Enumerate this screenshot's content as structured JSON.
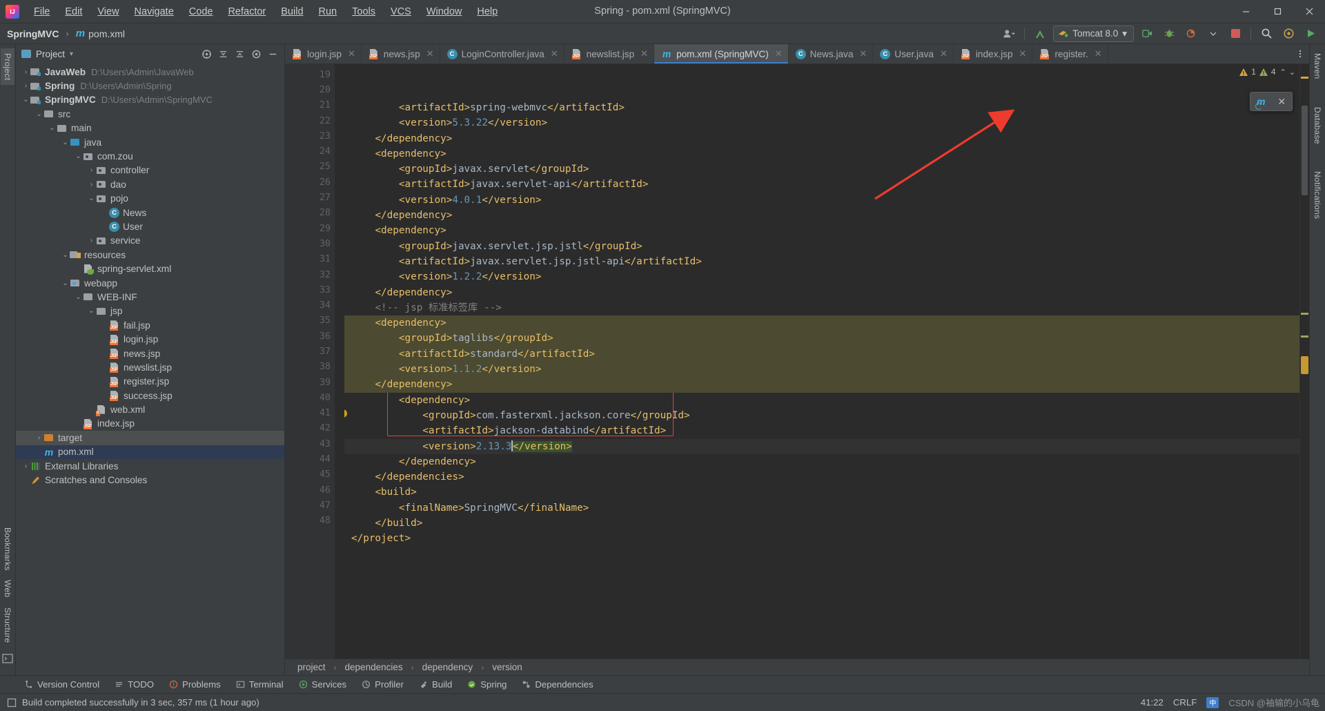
{
  "window": {
    "title": "Spring - pom.xml (SpringMVC)",
    "minimize": "—",
    "maximize": "❐",
    "close": "✕"
  },
  "menu": [
    {
      "label": "File"
    },
    {
      "label": "Edit"
    },
    {
      "label": "View"
    },
    {
      "label": "Navigate"
    },
    {
      "label": "Code"
    },
    {
      "label": "Refactor"
    },
    {
      "label": "Build"
    },
    {
      "label": "Run"
    },
    {
      "label": "Tools"
    },
    {
      "label": "VCS"
    },
    {
      "label": "Window"
    },
    {
      "label": "Help"
    }
  ],
  "navbar": {
    "project": "SpringMVC",
    "file": "pom.xml",
    "maven_glyph": "m",
    "run_config": "Tomcat 8.0",
    "dropdown_caret": "▾"
  },
  "left_rail": {
    "project_tab": "Project",
    "bookmarks_tab": "Bookmarks",
    "web_tab": "Web",
    "structure_tab": "Structure"
  },
  "right_rail": {
    "maven_tab": "Maven",
    "database_tab": "Database",
    "notifications_tab": "Notifications"
  },
  "project_panel": {
    "title": "Project",
    "caret": "▾",
    "tree": [
      {
        "depth": 0,
        "arrow": "›",
        "icon": "module-icon",
        "label": "JavaWeb",
        "bold": true,
        "path": "D:\\Users\\Admin\\JavaWeb"
      },
      {
        "depth": 0,
        "arrow": "›",
        "icon": "module-icon",
        "label": "Spring",
        "bold": true,
        "path": "D:\\Users\\Admin\\Spring"
      },
      {
        "depth": 0,
        "arrow": "⌄",
        "icon": "module-icon",
        "label": "SpringMVC",
        "bold": true,
        "path": "D:\\Users\\Admin\\SpringMVC"
      },
      {
        "depth": 1,
        "arrow": "⌄",
        "icon": "folder-icon",
        "label": "src",
        "bold": false,
        "path": ""
      },
      {
        "depth": 2,
        "arrow": "⌄",
        "icon": "folder-icon",
        "label": "main",
        "bold": false,
        "path": ""
      },
      {
        "depth": 3,
        "arrow": "⌄",
        "icon": "source-folder-icon",
        "label": "java",
        "bold": false,
        "path": ""
      },
      {
        "depth": 4,
        "arrow": "⌄",
        "icon": "package-icon",
        "label": "com.zou",
        "bold": false,
        "path": ""
      },
      {
        "depth": 5,
        "arrow": "›",
        "icon": "package-icon",
        "label": "controller",
        "bold": false,
        "path": ""
      },
      {
        "depth": 5,
        "arrow": "›",
        "icon": "package-icon",
        "label": "dao",
        "bold": false,
        "path": ""
      },
      {
        "depth": 5,
        "arrow": "⌄",
        "icon": "package-icon",
        "label": "pojo",
        "bold": false,
        "path": ""
      },
      {
        "depth": 6,
        "arrow": "",
        "icon": "java-class-icon",
        "label": "News",
        "bold": false,
        "path": ""
      },
      {
        "depth": 6,
        "arrow": "",
        "icon": "java-class-icon",
        "label": "User",
        "bold": false,
        "path": ""
      },
      {
        "depth": 5,
        "arrow": "›",
        "icon": "package-icon",
        "label": "service",
        "bold": false,
        "path": ""
      },
      {
        "depth": 3,
        "arrow": "⌄",
        "icon": "resources-folder-icon",
        "label": "resources",
        "bold": false,
        "path": ""
      },
      {
        "depth": 4,
        "arrow": "",
        "icon": "spring-xml-icon",
        "label": "spring-servlet.xml",
        "bold": false,
        "path": ""
      },
      {
        "depth": 3,
        "arrow": "⌄",
        "icon": "webapp-folder-icon",
        "label": "webapp",
        "bold": false,
        "path": ""
      },
      {
        "depth": 4,
        "arrow": "⌄",
        "icon": "folder-icon",
        "label": "WEB-INF",
        "bold": false,
        "path": ""
      },
      {
        "depth": 5,
        "arrow": "⌄",
        "icon": "folder-icon",
        "label": "jsp",
        "bold": false,
        "path": ""
      },
      {
        "depth": 6,
        "arrow": "",
        "icon": "jsp-file-icon",
        "label": "fail.jsp",
        "bold": false,
        "path": ""
      },
      {
        "depth": 6,
        "arrow": "",
        "icon": "jsp-file-icon",
        "label": "login.jsp",
        "bold": false,
        "path": ""
      },
      {
        "depth": 6,
        "arrow": "",
        "icon": "jsp-file-icon",
        "label": "news.jsp",
        "bold": false,
        "path": ""
      },
      {
        "depth": 6,
        "arrow": "",
        "icon": "jsp-file-icon",
        "label": "newslist.jsp",
        "bold": false,
        "path": ""
      },
      {
        "depth": 6,
        "arrow": "",
        "icon": "jsp-file-icon",
        "label": "register.jsp",
        "bold": false,
        "path": ""
      },
      {
        "depth": 6,
        "arrow": "",
        "icon": "jsp-file-icon",
        "label": "success.jsp",
        "bold": false,
        "path": ""
      },
      {
        "depth": 5,
        "arrow": "",
        "icon": "xml-file-icon",
        "label": "web.xml",
        "bold": false,
        "path": ""
      },
      {
        "depth": 4,
        "arrow": "",
        "icon": "jsp-file-icon",
        "label": "index.jsp",
        "bold": false,
        "path": ""
      },
      {
        "depth": 1,
        "arrow": "›",
        "icon": "target-folder-icon",
        "label": "target",
        "bold": false,
        "path": "",
        "state": "hover"
      },
      {
        "depth": 1,
        "arrow": "",
        "icon": "maven-pom-icon",
        "label": "pom.xml",
        "bold": false,
        "path": "",
        "state": "selected"
      },
      {
        "depth": 0,
        "arrow": "›",
        "icon": "libraries-icon",
        "label": "External Libraries",
        "bold": false,
        "path": ""
      },
      {
        "depth": 0,
        "arrow": "",
        "icon": "scratches-icon",
        "label": "Scratches and Consoles",
        "bold": false,
        "path": ""
      }
    ]
  },
  "editor_tabs": [
    {
      "label": "login.jsp",
      "icon": "jsp-file-icon",
      "active": false
    },
    {
      "label": "news.jsp",
      "icon": "jsp-file-icon",
      "active": false
    },
    {
      "label": "LoginController.java",
      "icon": "java-class-icon",
      "active": false
    },
    {
      "label": "newslist.jsp",
      "icon": "jsp-file-icon",
      "active": false
    },
    {
      "label": "pom.xml (SpringMVC)",
      "icon": "maven-pom-icon",
      "active": true
    },
    {
      "label": "News.java",
      "icon": "java-class-icon",
      "active": false
    },
    {
      "label": "User.java",
      "icon": "java-class-icon",
      "active": false
    },
    {
      "label": "index.jsp",
      "icon": "jsp-file-icon",
      "active": false
    },
    {
      "label": "register.",
      "icon": "jsp-file-icon",
      "active": false
    }
  ],
  "inspections": {
    "warning_count": "1",
    "weak_warning_count": "4",
    "up_caret": "⌃",
    "down_caret": "⌄"
  },
  "maven_popup": {
    "reload_glyph": "m",
    "close_glyph": "✕"
  },
  "code_lines": [
    {
      "n": "19",
      "fold": "",
      "parts": [
        {
          "t": "        ",
          "c": "txt"
        },
        {
          "t": "<artifactId>",
          "c": "tag"
        },
        {
          "t": "spring-webmvc",
          "c": "txt"
        },
        {
          "t": "</artifactId>",
          "c": "tag"
        }
      ]
    },
    {
      "n": "20",
      "fold": "",
      "parts": [
        {
          "t": "        ",
          "c": "txt"
        },
        {
          "t": "<version>",
          "c": "tag"
        },
        {
          "t": "5.3.22",
          "c": "num"
        },
        {
          "t": "</version>",
          "c": "tag"
        }
      ]
    },
    {
      "n": "21",
      "fold": "⊓",
      "parts": [
        {
          "t": "    ",
          "c": "txt"
        },
        {
          "t": "</dependency>",
          "c": "tag"
        }
      ]
    },
    {
      "n": "22",
      "fold": "⊔",
      "parts": [
        {
          "t": "    ",
          "c": "txt"
        },
        {
          "t": "<dependency>",
          "c": "tag"
        }
      ]
    },
    {
      "n": "23",
      "fold": "",
      "parts": [
        {
          "t": "        ",
          "c": "txt"
        },
        {
          "t": "<groupId>",
          "c": "tag"
        },
        {
          "t": "javax.servlet",
          "c": "txt"
        },
        {
          "t": "</groupId>",
          "c": "tag"
        }
      ]
    },
    {
      "n": "24",
      "fold": "",
      "parts": [
        {
          "t": "        ",
          "c": "txt"
        },
        {
          "t": "<artifactId>",
          "c": "tag"
        },
        {
          "t": "javax.servlet-api",
          "c": "txt"
        },
        {
          "t": "</artifactId>",
          "c": "tag"
        }
      ]
    },
    {
      "n": "25",
      "fold": "",
      "parts": [
        {
          "t": "        ",
          "c": "txt"
        },
        {
          "t": "<version>",
          "c": "tag"
        },
        {
          "t": "4.0.1",
          "c": "num"
        },
        {
          "t": "</version>",
          "c": "tag"
        }
      ]
    },
    {
      "n": "26",
      "fold": "⊓",
      "parts": [
        {
          "t": "    ",
          "c": "txt"
        },
        {
          "t": "</dependency>",
          "c": "tag"
        }
      ]
    },
    {
      "n": "27",
      "fold": "⊔",
      "parts": [
        {
          "t": "    ",
          "c": "txt"
        },
        {
          "t": "<dependency>",
          "c": "tag"
        }
      ]
    },
    {
      "n": "28",
      "fold": "",
      "parts": [
        {
          "t": "        ",
          "c": "txt"
        },
        {
          "t": "<groupId>",
          "c": "tag"
        },
        {
          "t": "javax.servlet.jsp.jstl",
          "c": "txt"
        },
        {
          "t": "</groupId>",
          "c": "tag"
        }
      ]
    },
    {
      "n": "29",
      "fold": "",
      "parts": [
        {
          "t": "        ",
          "c": "txt"
        },
        {
          "t": "<artifactId>",
          "c": "tag"
        },
        {
          "t": "javax.servlet.jsp.jstl-api",
          "c": "txt"
        },
        {
          "t": "</artifactId>",
          "c": "tag"
        }
      ]
    },
    {
      "n": "30",
      "fold": "",
      "parts": [
        {
          "t": "        ",
          "c": "txt"
        },
        {
          "t": "<version>",
          "c": "tag"
        },
        {
          "t": "1.2.2",
          "c": "num"
        },
        {
          "t": "</version>",
          "c": "tag"
        }
      ]
    },
    {
      "n": "31",
      "fold": "⊓",
      "parts": [
        {
          "t": "    ",
          "c": "txt"
        },
        {
          "t": "</dependency>",
          "c": "tag"
        }
      ]
    },
    {
      "n": "32",
      "fold": "",
      "parts": [
        {
          "t": "    ",
          "c": "txt"
        },
        {
          "t": "<!-- jsp 标准标签库 -->",
          "c": "cmt"
        }
      ]
    },
    {
      "n": "33",
      "fold": "⊔",
      "hl": true,
      "parts": [
        {
          "t": "    ",
          "c": "txt"
        },
        {
          "t": "<dependency>",
          "c": "tag"
        }
      ]
    },
    {
      "n": "34",
      "fold": "",
      "hl": true,
      "parts": [
        {
          "t": "        ",
          "c": "txt"
        },
        {
          "t": "<groupId>",
          "c": "tag"
        },
        {
          "t": "taglibs",
          "c": "txt"
        },
        {
          "t": "</groupId>",
          "c": "tag"
        }
      ]
    },
    {
      "n": "35",
      "fold": "",
      "hl": true,
      "parts": [
        {
          "t": "        ",
          "c": "txt"
        },
        {
          "t": "<artifactId>",
          "c": "tag"
        },
        {
          "t": "standard",
          "c": "txt"
        },
        {
          "t": "</artifactId>",
          "c": "tag"
        }
      ]
    },
    {
      "n": "36",
      "fold": "",
      "hl": true,
      "parts": [
        {
          "t": "        ",
          "c": "txt"
        },
        {
          "t": "<version>",
          "c": "tag"
        },
        {
          "t": "1.1.2",
          "c": "num"
        },
        {
          "t": "</version>",
          "c": "tag"
        }
      ]
    },
    {
      "n": "37",
      "fold": "⊓",
      "hl": true,
      "parts": [
        {
          "t": "    ",
          "c": "txt"
        },
        {
          "t": "</dependency>",
          "c": "tag"
        }
      ]
    },
    {
      "n": "38",
      "fold": "⊔",
      "parts": [
        {
          "t": "        ",
          "c": "txt"
        },
        {
          "t": "<dependency>",
          "c": "tag"
        }
      ]
    },
    {
      "n": "39",
      "fold": "",
      "parts": [
        {
          "t": "            ",
          "c": "txt"
        },
        {
          "t": "<groupId>",
          "c": "tag"
        },
        {
          "t": "com.fasterxml.jackson.core",
          "c": "txt"
        },
        {
          "t": "</groupId>",
          "c": "tag"
        }
      ]
    },
    {
      "n": "40",
      "fold": "",
      "parts": [
        {
          "t": "            ",
          "c": "txt"
        },
        {
          "t": "<artifactId>",
          "c": "tag"
        },
        {
          "t": "jackson-databind",
          "c": "txt"
        },
        {
          "t": "</artifactId>",
          "c": "tag"
        }
      ]
    },
    {
      "n": "41",
      "fold": "",
      "cur": true,
      "bulb": true,
      "parts": [
        {
          "t": "            ",
          "c": "txt"
        },
        {
          "t": "<version>",
          "c": "tag"
        },
        {
          "t": "2.13.3",
          "c": "num"
        },
        {
          "t": "|",
          "c": "caret"
        },
        {
          "t": "</version>",
          "c": "green"
        }
      ]
    },
    {
      "n": "42",
      "fold": "⊓",
      "parts": [
        {
          "t": "        ",
          "c": "txt"
        },
        {
          "t": "</dependency>",
          "c": "tag"
        }
      ]
    },
    {
      "n": "43",
      "fold": "",
      "parts": [
        {
          "t": "    ",
          "c": "txt"
        },
        {
          "t": "</dependencies>",
          "c": "tag"
        }
      ]
    },
    {
      "n": "44",
      "fold": "⊔",
      "parts": [
        {
          "t": "    ",
          "c": "txt"
        },
        {
          "t": "<build>",
          "c": "tag"
        }
      ]
    },
    {
      "n": "45",
      "fold": "",
      "parts": [
        {
          "t": "        ",
          "c": "txt"
        },
        {
          "t": "<finalName>",
          "c": "tag"
        },
        {
          "t": "SpringMVC",
          "c": "txt"
        },
        {
          "t": "</finalName>",
          "c": "tag"
        }
      ]
    },
    {
      "n": "46",
      "fold": "⊓",
      "parts": [
        {
          "t": "    ",
          "c": "txt"
        },
        {
          "t": "</build>",
          "c": "tag"
        }
      ]
    },
    {
      "n": "47",
      "fold": "⊓",
      "parts": [
        {
          "t": "",
          "c": "txt"
        },
        {
          "t": "</project>",
          "c": "tag"
        }
      ]
    },
    {
      "n": "48",
      "fold": "",
      "parts": []
    }
  ],
  "breadcrumb": [
    "project",
    "dependencies",
    "dependency",
    "version"
  ],
  "bottom_tools": [
    {
      "label": "Version Control",
      "icon": "version-control-icon"
    },
    {
      "label": "TODO",
      "icon": "todo-icon"
    },
    {
      "label": "Problems",
      "icon": "problems-icon"
    },
    {
      "label": "Terminal",
      "icon": "terminal-icon"
    },
    {
      "label": "Services",
      "icon": "services-icon"
    },
    {
      "label": "Profiler",
      "icon": "profiler-icon"
    },
    {
      "label": "Build",
      "icon": "build-icon"
    },
    {
      "label": "Spring",
      "icon": "spring-icon"
    },
    {
      "label": "Dependencies",
      "icon": "dependencies-icon"
    }
  ],
  "status": {
    "message": "Build completed successfully in 3 sec, 357 ms (1 hour ago)",
    "caret_position": "41:22",
    "line_separator": "CRLF",
    "ime": "中",
    "watermark": "CSDN @袖输的小乌龟"
  },
  "colors": {
    "accent": "#3d7fcc",
    "selection_olive": "#4c4a30",
    "error_box": "#e0453d",
    "arrow": "#ef3b2d",
    "tag": "#e8bf6a",
    "value": "#a9b7c6",
    "number": "#6897bb",
    "comment": "#808080"
  }
}
